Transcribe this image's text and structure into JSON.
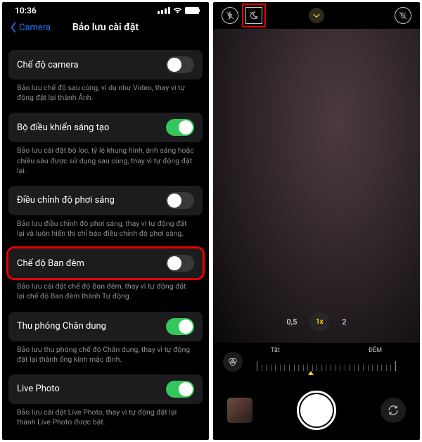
{
  "left": {
    "status": {
      "time": "10:36"
    },
    "nav": {
      "back": "Camera",
      "title": "Bảo lưu cài đặt"
    },
    "items": [
      {
        "label": "Chế độ camera",
        "desc": "Bảo lưu chế độ sau cùng, ví dụ như Video, thay vì tự động đặt lại thành Ảnh.",
        "on": false,
        "highlight": false
      },
      {
        "label": "Bộ điều khiển sáng tạo",
        "desc": "Bảo lưu cài đặt bộ lọc, tỷ lệ khung hình, ánh sáng hoặc chiều sâu được sử dụng sau cùng, thay vì tự động đặt lại.",
        "on": true,
        "highlight": false
      },
      {
        "label": "Điều chỉnh độ phơi sáng",
        "desc": "Bảo lưu điều chỉnh độ phơi sáng, thay vì tự động đặt lại và luôn hiển thị chỉ báo điều chỉnh độ phơi sáng.",
        "on": false,
        "highlight": false
      },
      {
        "label": "Chế độ Ban đêm",
        "desc": "Bảo lưu cài đặt chế độ Ban đêm, thay vì tự động đặt lại chế độ Ban đêm thành Tự động.",
        "on": false,
        "highlight": true
      },
      {
        "label": "Thu phóng Chân dung",
        "desc": "Bảo lưu thu phóng chế độ Chân dung, thay vì tự động đặt lại thành ống kính mặc định.",
        "on": true,
        "highlight": false
      },
      {
        "label": "Live Photo",
        "desc": "Bảo lưu cài đặt Live Photo, thay vì tự động đặt lại thành Live Photo được bật.",
        "on": true,
        "highlight": false
      }
    ]
  },
  "right": {
    "zoom": {
      "levels": [
        "0,5",
        "1x",
        "2"
      ],
      "active_index": 1
    },
    "dial": {
      "left_label": "Tắt",
      "right_label": "ĐÊM"
    }
  }
}
